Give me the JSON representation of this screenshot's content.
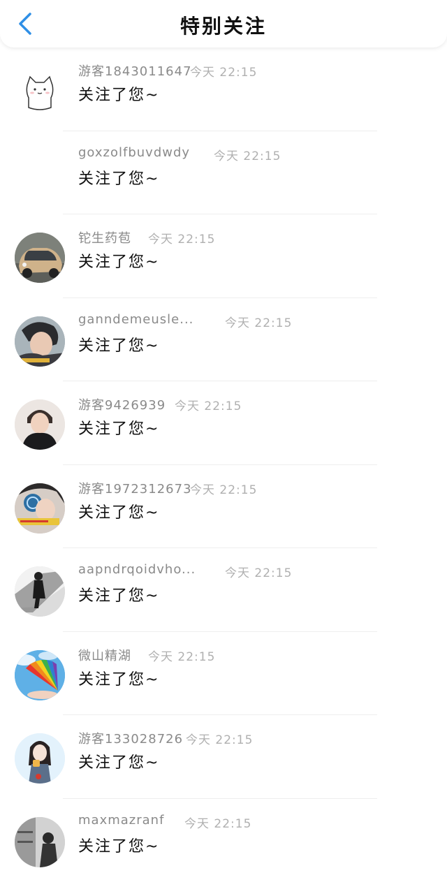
{
  "header": {
    "title": "特别关注"
  },
  "colors": {
    "accent": "#2f8fe6"
  },
  "items": [
    {
      "name": "游客1843011647",
      "time": "今天 22:15",
      "message": "关注了您~",
      "avatar": "cat-drawing"
    },
    {
      "name": "goxzolfbuvdwdy",
      "time": "今天 22:15",
      "message": "关注了您~",
      "avatar": "none"
    },
    {
      "name": "铊生药苞",
      "time": "今天 22:15",
      "message": "关注了您~",
      "avatar": "car-photo"
    },
    {
      "name": "ganndemeusle...",
      "time": "今天 22:15",
      "message": "关注了您~",
      "avatar": "person-photo"
    },
    {
      "name": "游客9426939",
      "time": "今天 22:15",
      "message": "关注了您~",
      "avatar": "person-photo"
    },
    {
      "name": "游客1972312673",
      "time": "今天 22:15",
      "message": "关注了您~",
      "avatar": "person-photo"
    },
    {
      "name": "aapndrqoidvho...",
      "time": "今天 22:15",
      "message": "关注了您~",
      "avatar": "person-photo"
    },
    {
      "name": "微山精湖",
      "time": "今天 22:15",
      "message": "关注了您~",
      "avatar": "rainbow-fan"
    },
    {
      "name": "游客133028726",
      "time": "今天 22:15",
      "message": "关注了您~",
      "avatar": "girl-drawing"
    },
    {
      "name": "maxmazranf",
      "time": "今天 22:15",
      "message": "关注了您~",
      "avatar": "person-photo"
    }
  ]
}
